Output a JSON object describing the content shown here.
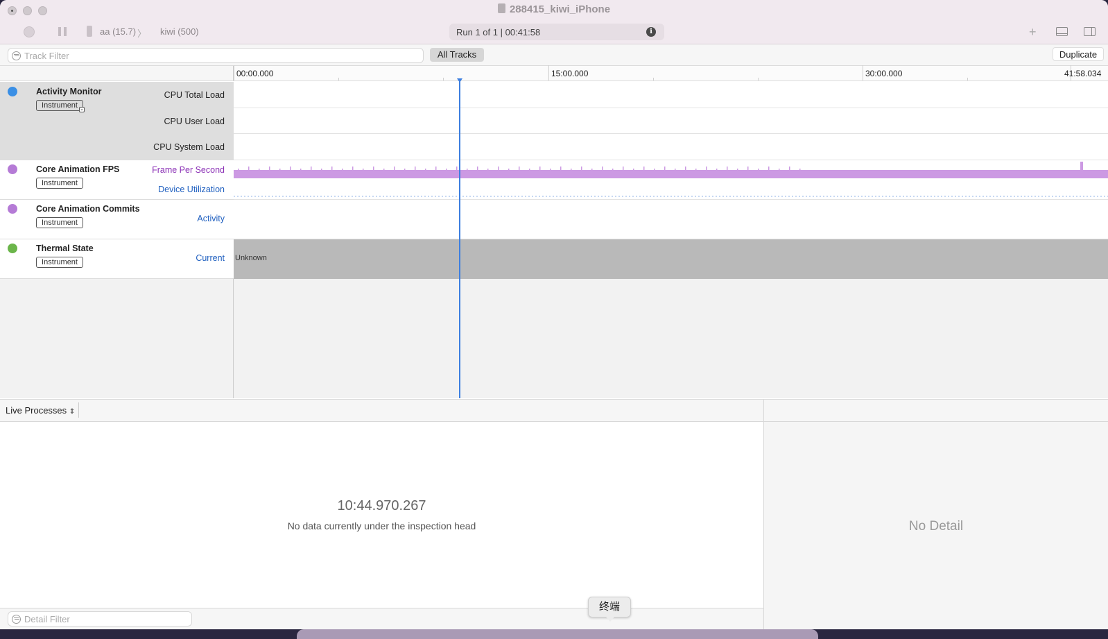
{
  "window": {
    "title": "288415_kiwi_iPhone"
  },
  "toolbar": {
    "device": "aa (15.7)",
    "process": "kiwi (500)",
    "run_status": "Run 1 of 1  |  00:41:58",
    "add_symbol": "+"
  },
  "filter": {
    "track_filter_placeholder": "Track Filter",
    "all_tracks_label": "All Tracks",
    "duplicate_label": "Duplicate"
  },
  "ruler": {
    "ticks": [
      "00:00.000",
      "15:00.000",
      "30:00.000",
      "41:58.034"
    ]
  },
  "tracks": [
    {
      "name": "Activity Monitor",
      "badge": "Instrument",
      "lanes": [
        "CPU Total Load",
        "CPU User Load",
        "CPU System Load"
      ],
      "icon": "activity-monitor-icon",
      "color": "#3a8fe5"
    },
    {
      "name": "Core Animation FPS",
      "badge": "Instrument",
      "lanes": [
        "Frame Per Second",
        "Device Utilization"
      ],
      "icon": "core-animation-icon",
      "color": "#b57bd6"
    },
    {
      "name": "Core Animation Commits",
      "badge": "Instrument",
      "lanes": [
        "Activity"
      ],
      "icon": "core-animation-icon",
      "color": "#b57bd6"
    },
    {
      "name": "Thermal State",
      "badge": "Instrument",
      "lanes": [
        "Current"
      ],
      "icon": "thermal-icon",
      "color": "#6bb54a",
      "value": "Unknown"
    }
  ],
  "lane_colors": {
    "purple": "#8a2fb5",
    "blue": "#2060c0",
    "fps_fill": "#cc99e3"
  },
  "bottom": {
    "live_processes_label": "Live Processes",
    "timestamp": "10:44.970.267",
    "no_data": "No data currently under the inspection head",
    "no_detail": "No Detail",
    "detail_filter_placeholder": "Detail Filter"
  },
  "dock": {
    "tooltip": "终端"
  }
}
